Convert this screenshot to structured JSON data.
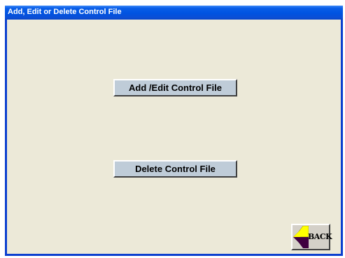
{
  "window": {
    "title": "Add, Edit or Delete Control File"
  },
  "buttons": {
    "add_edit_label": "Add /Edit Control File",
    "delete_label": "Delete Control File",
    "back_label": "BACK"
  },
  "icons": {
    "back": "back-arrow-icon"
  },
  "colors": {
    "titlebar": "#0053e1",
    "window_bg": "#ece9d8",
    "button_bg": "#bfccd8",
    "back_arrow_yellow": "#ffff00",
    "back_arrow_purple": "#400040"
  }
}
